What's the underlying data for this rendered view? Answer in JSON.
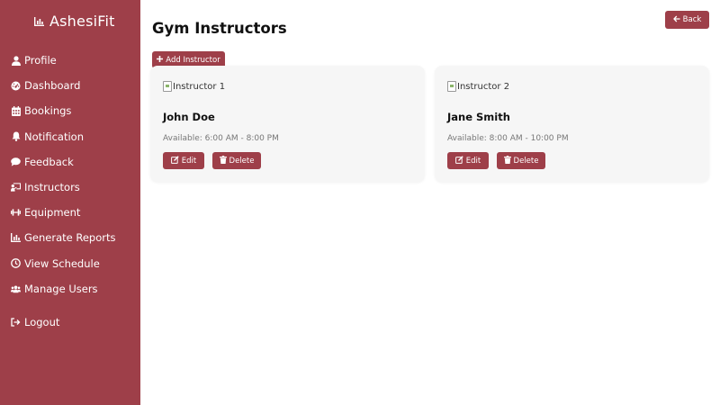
{
  "brand": {
    "name": "AshesiFit",
    "icon": "chart-bar-icon"
  },
  "sidebar": {
    "items": [
      {
        "label": "Profile",
        "icon": "user-icon"
      },
      {
        "label": "Dashboard",
        "icon": "gauge-icon"
      },
      {
        "label": "Bookings",
        "icon": "calendar-icon"
      },
      {
        "label": "Notification",
        "icon": "bell-icon"
      },
      {
        "label": "Feedback",
        "icon": "comment-icon"
      },
      {
        "label": "Instructors",
        "icon": "chalkboard-user-icon"
      },
      {
        "label": "Equipment",
        "icon": "dumbbell-icon"
      },
      {
        "label": "Generate Reports",
        "icon": "chart-bar-icon"
      },
      {
        "label": "View Schedule",
        "icon": "clock-icon"
      },
      {
        "label": "Manage Users",
        "icon": "users-icon"
      }
    ],
    "logout": {
      "label": "Logout",
      "icon": "sign-out-icon"
    }
  },
  "header": {
    "title": "Gym Instructors",
    "back_label": "Back"
  },
  "toolbar": {
    "add_label": "Add Instructor"
  },
  "instructors": [
    {
      "image_alt": "Instructor 1",
      "name": "John Doe",
      "availability": "Available: 6:00 AM - 8:00 PM",
      "edit_label": "Edit",
      "delete_label": "Delete"
    },
    {
      "image_alt": "Instructor 2",
      "name": "Jane Smith",
      "availability": "Available: 8:00 AM - 10:00 PM",
      "edit_label": "Edit",
      "delete_label": "Delete"
    }
  ],
  "colors": {
    "accent": "#9e3f49",
    "card_bg": "#f6f6f6",
    "muted_text": "#777777"
  }
}
